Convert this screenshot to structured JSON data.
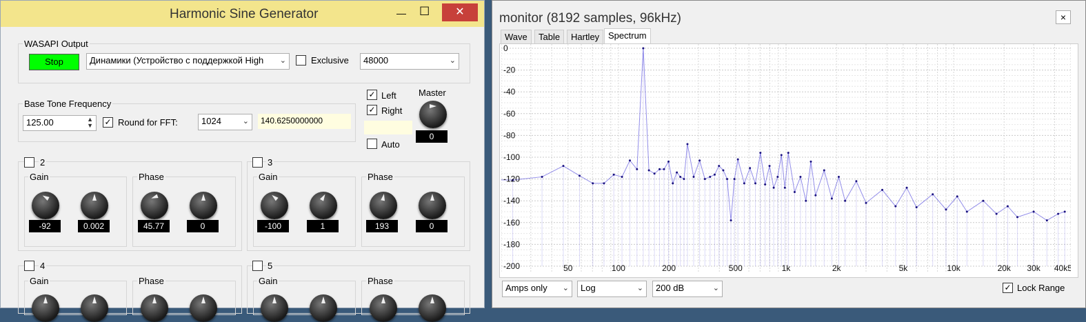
{
  "left_window": {
    "title": "Harmonic Sine Generator",
    "minimize": "—",
    "maximize": "☐",
    "close": "✕",
    "wasapi_group": "WASAPI Output",
    "stop_label": "Stop",
    "device": "Динамики (Устройство с поддержкой High",
    "exclusive_label": "Exclusive",
    "sample_rate": "48000",
    "base_group": "Base Tone Frequency",
    "base_freq": "125.00",
    "round_fft_label": "Round for FFT:",
    "fft_size": "1024",
    "rounded_freq": "140.6250000000",
    "left_label": "Left",
    "right_label": "Right",
    "auto_label": "Auto",
    "master_label": "Master",
    "master_value": "0",
    "harmonics": [
      {
        "num": "2",
        "gain_label": "Gain",
        "phase_label": "Phase",
        "gain": "-92",
        "gain_fine": "0.002",
        "phase": "45.77",
        "phase_fine": "0"
      },
      {
        "num": "3",
        "gain_label": "Gain",
        "phase_label": "Phase",
        "gain": "-100",
        "gain_fine": "1",
        "phase": "193",
        "phase_fine": "0"
      },
      {
        "num": "4",
        "gain_label": "Gain",
        "phase_label": "Phase"
      },
      {
        "num": "5",
        "gain_label": "Gain",
        "phase_label": "Phase"
      }
    ]
  },
  "right_window": {
    "title": "monitor (8192 samples, 96kHz)",
    "close": "×",
    "tabs": [
      "Wave",
      "Table",
      "Hartley",
      "Spectrum"
    ],
    "mode": "Amps only",
    "scale": "Log",
    "range": "200 dB",
    "lock_range_label": "Lock Range",
    "lock_range_checked": true
  },
  "chart_data": {
    "type": "line",
    "title": "",
    "xlabel": "",
    "ylabel": "",
    "x_scale": "log",
    "xlim": [
      20,
      50000
    ],
    "ylim": [
      -200,
      0
    ],
    "x_ticks": [
      "50",
      "100",
      "200",
      "500",
      "1k",
      "2k",
      "5k",
      "10k",
      "20k",
      "30k",
      "40k5"
    ],
    "x_tick_values": [
      50,
      100,
      200,
      500,
      1000,
      2000,
      5000,
      10000,
      20000,
      30000,
      45000
    ],
    "y_ticks": [
      "0",
      "-20",
      "-40",
      "-60",
      "-80",
      "-100",
      "-120",
      "-140",
      "-160",
      "-180",
      "-200"
    ],
    "y_tick_values": [
      0,
      -20,
      -40,
      -60,
      -80,
      -100,
      -120,
      -140,
      -160,
      -180,
      -200
    ],
    "grid": true,
    "series": [
      {
        "color": "#3b32d9",
        "x": [
          11.7,
          23.4,
          35,
          46.9,
          58.6,
          70.3,
          82,
          93.8,
          105,
          117,
          129,
          140.6,
          152,
          164,
          176,
          187,
          199,
          211,
          223,
          234,
          246,
          258,
          281,
          305,
          328,
          352,
          375,
          398,
          422,
          445,
          469,
          492,
          516,
          563,
          609,
          656,
          703,
          750,
          797,
          844,
          891,
          938,
          984,
          1031,
          1125,
          1219,
          1313,
          1406,
          1500,
          1688,
          1875,
          2063,
          2250,
          2625,
          3000,
          3750,
          4500,
          5250,
          6000,
          7500,
          9000,
          10500,
          12000,
          15000,
          18000,
          21000,
          24000,
          30000,
          36000,
          42000,
          46000
        ],
        "y": [
          -120,
          -121,
          -118,
          -108,
          -117,
          -124,
          -124,
          -116,
          -118,
          -103,
          -111,
          0,
          -112,
          -115,
          -111,
          -111,
          -104,
          -124,
          -114,
          -118,
          -120,
          -88,
          -118,
          -103,
          -120,
          -118,
          -116,
          -108,
          -112,
          -120,
          -158,
          -120,
          -102,
          -124,
          -110,
          -124,
          -96,
          -125,
          -108,
          -128,
          -118,
          -98,
          -128,
          -96,
          -132,
          -118,
          -140,
          -104,
          -135,
          -112,
          -138,
          -118,
          -140,
          -122,
          -142,
          -130,
          -145,
          -128,
          -146,
          -134,
          -148,
          -136,
          -150,
          -140,
          -152,
          -145,
          -155,
          -150,
          -158,
          -152,
          -150
        ]
      }
    ]
  }
}
